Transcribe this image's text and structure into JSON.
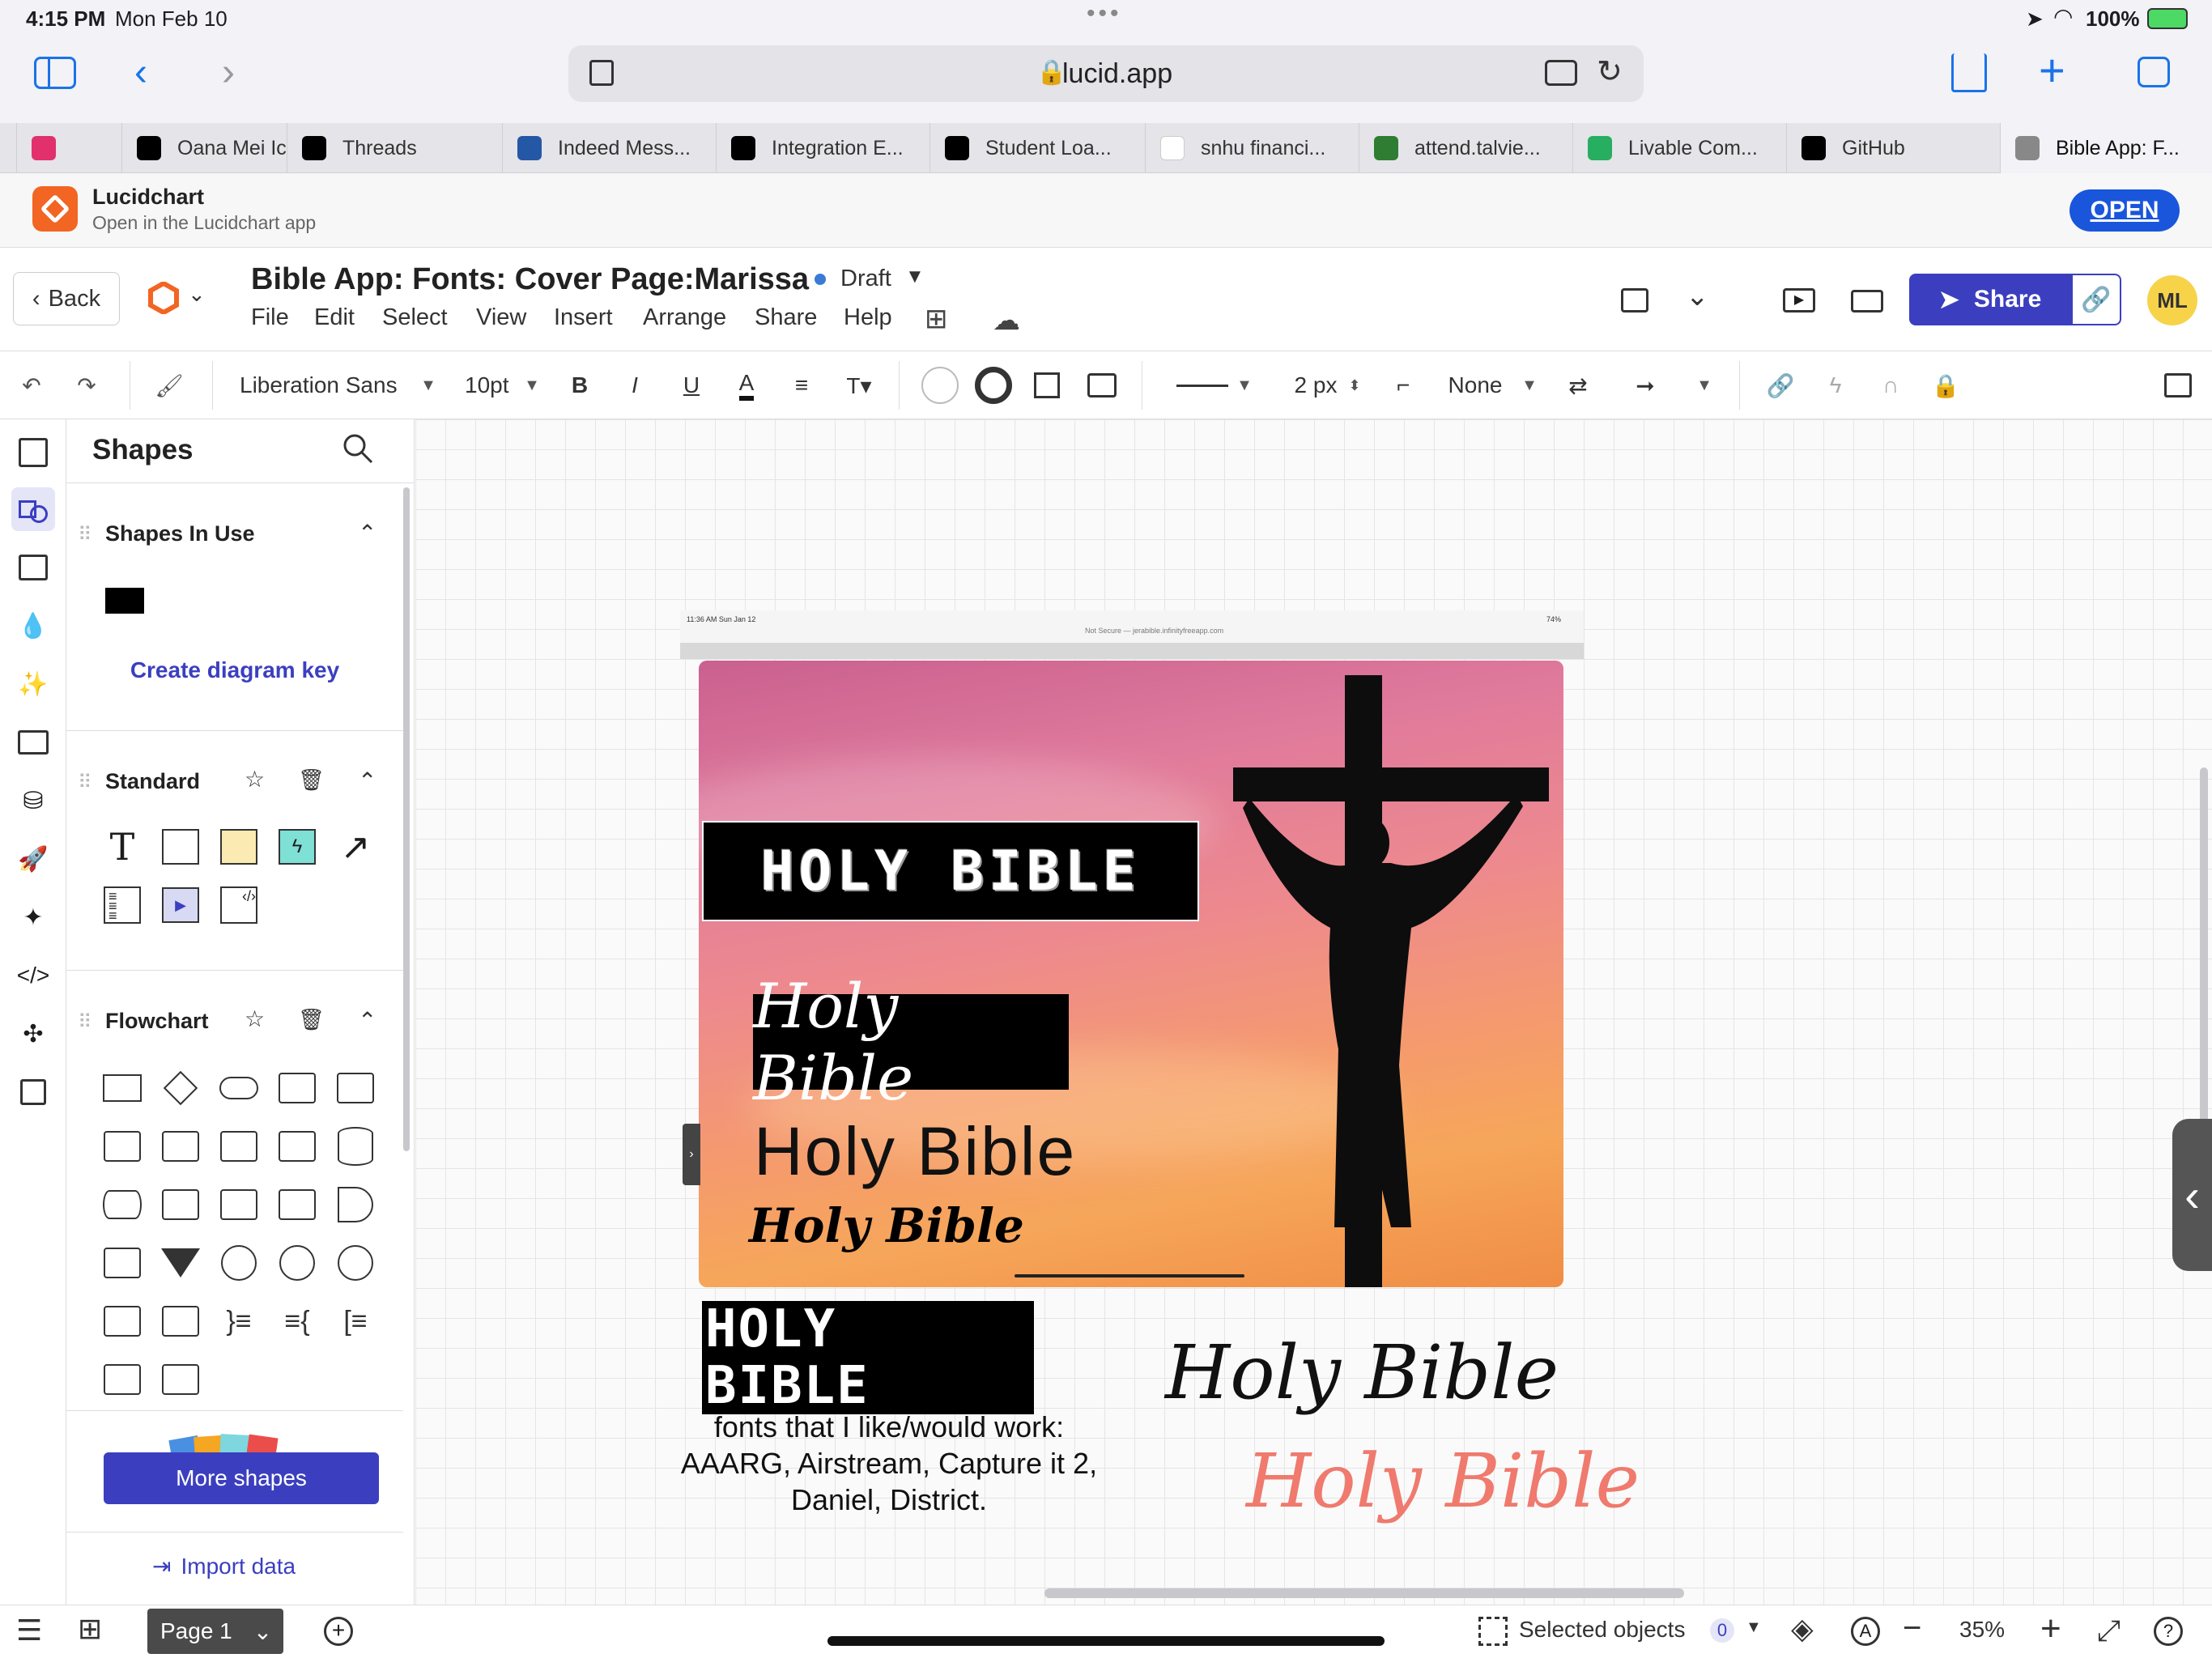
{
  "status": {
    "time": "4:15 PM",
    "date": "Mon Feb 10",
    "battery": "100%"
  },
  "browser": {
    "url": "lucid.app"
  },
  "tabs": [
    {
      "label": "",
      "fav": "#e1306c"
    },
    {
      "label": "Oana Mei Ic",
      "fav": "#000"
    },
    {
      "label": "Threads",
      "fav": "#000"
    },
    {
      "label": "Indeed Mess...",
      "fav": "#2557a7"
    },
    {
      "label": "Integration E...",
      "fav": "#000"
    },
    {
      "label": "Student Loa...",
      "fav": "#000"
    },
    {
      "label": "snhu financi...",
      "fav": "#fff"
    },
    {
      "label": "attend.talvie...",
      "fav": "#2e7d32"
    },
    {
      "label": "Livable Com...",
      "fav": "#27ae60"
    },
    {
      "label": "GitHub",
      "fav": "#000"
    },
    {
      "label": "Bible App: F...",
      "fav": "#888"
    }
  ],
  "banner": {
    "title": "Lucidchart",
    "subtitle": "Open in the Lucidchart app",
    "open_label": "OPEN"
  },
  "header": {
    "back_label": "Back",
    "doc_title": "Bible App: Fonts: Cover Page:Marissa",
    "status": "Draft",
    "menus": [
      "File",
      "Edit",
      "Select",
      "View",
      "Insert",
      "Arrange",
      "Share",
      "Help"
    ],
    "share_label": "Share",
    "avatar": "ML"
  },
  "toolbar": {
    "font": "Liberation Sans",
    "font_size": "10pt",
    "line_width": "2 px",
    "arrow_none": "None"
  },
  "panel": {
    "title": "Shapes",
    "sections": [
      "Shapes In Use",
      "Standard",
      "Flowchart"
    ],
    "create_key": "Create diagram key",
    "more_shapes": "More shapes",
    "import_data": "Import data"
  },
  "canvas": {
    "screenshot_status_left": "11:36 AM  Sun Jan 12",
    "screenshot_url": "Not Secure — jerabible.infinityfreeapp.com",
    "screenshot_battery": "74%",
    "title_grunge": "HOLY BIBLE",
    "title_script": "Holy Bible",
    "title_thin": "Holy Bible",
    "title_brush": "Holy Bible",
    "title_stencil": "HOLY BIBLE",
    "note": "fonts that I like/would work: AAARG, Airstream, Capture it 2, Daniel, District.",
    "hand_black": "Holy Bible",
    "hand_red": "Holy Bible"
  },
  "bottom": {
    "page_label": "Page 1",
    "selected_label": "Selected objects",
    "selected_count": "0",
    "zoom": "35%"
  },
  "colors": {
    "accent": "#3b3fbf",
    "banner_open": "#1a56db",
    "avatar_bg": "#f7d34a"
  }
}
